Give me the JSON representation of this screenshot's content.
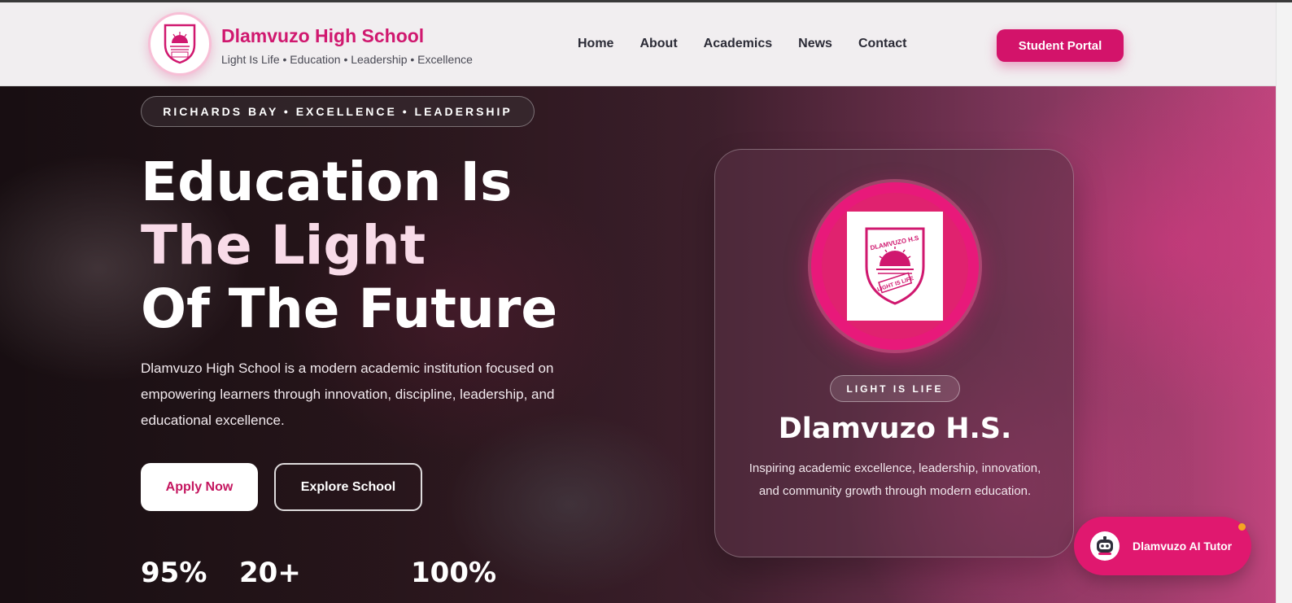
{
  "colors": {
    "brand": "#d0186f",
    "accent": "#e0186f",
    "header_bg": "#f1eef0"
  },
  "header": {
    "brand_name": "Dlamvuzo High School",
    "tagline": "Light Is Life • Education • Leadership • Excellence",
    "nav": [
      "Home",
      "About",
      "Academics",
      "News",
      "Contact"
    ],
    "portal_label": "Student Portal"
  },
  "hero": {
    "pill": "RICHARDS BAY • EXCELLENCE • LEADERSHIP",
    "headline_line1": "Education Is",
    "headline_pink": "The Light",
    "headline_line3": "Of The Future",
    "lead": "Dlamvuzo High School is a modern academic institution focused on empowering learners through innovation, discipline, leadership, and educational excellence.",
    "apply_label": "Apply Now",
    "explore_label": "Explore School",
    "stats": [
      "95%",
      "20+",
      "100%"
    ]
  },
  "card": {
    "crest_text_top": "DLAMVUZO H.S",
    "crest_text_bottom": "LIGHT IS LIFE",
    "pill": "LIGHT IS LIFE",
    "title": "Dlamvuzo H.S.",
    "description": "Inspiring academic excellence, leadership, innovation, and community growth through modern education."
  },
  "tutor": {
    "label": "Dlamvuzo AI Tutor",
    "icon": "robot-avatar-icon"
  }
}
